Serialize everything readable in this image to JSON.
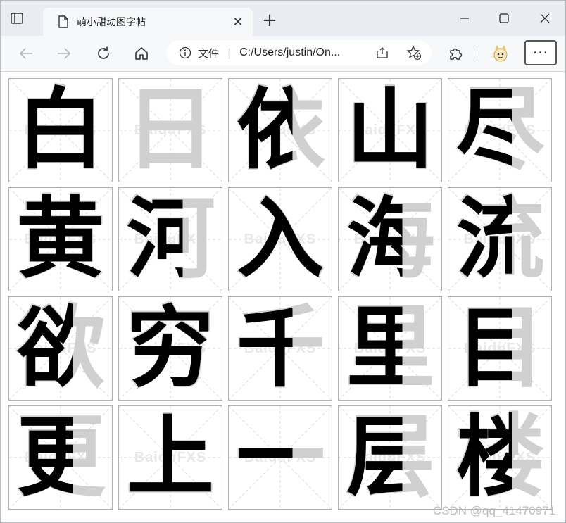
{
  "browser": {
    "tab_title": "萌小甜动图字帖",
    "address_label": "文件",
    "address_url": "C:/Users/justin/On..."
  },
  "cells": [
    {
      "char": "白",
      "state": "complete"
    },
    {
      "char": "日",
      "state": "ghost"
    },
    {
      "char": "依",
      "state": "partial"
    },
    {
      "char": "山",
      "state": "complete"
    },
    {
      "char": "尽",
      "state": "partial"
    },
    {
      "char": "黄",
      "state": "complete"
    },
    {
      "char": "河",
      "state": "partial"
    },
    {
      "char": "入",
      "state": "complete"
    },
    {
      "char": "海",
      "state": "partial"
    },
    {
      "char": "流",
      "state": "partial"
    },
    {
      "char": "欲",
      "state": "partial"
    },
    {
      "char": "穷",
      "state": "complete"
    },
    {
      "char": "千",
      "state": "partial"
    },
    {
      "char": "里",
      "state": "partial"
    },
    {
      "char": "目",
      "state": "partial"
    },
    {
      "char": "更",
      "state": "partial"
    },
    {
      "char": "上",
      "state": "complete"
    },
    {
      "char": "一",
      "state": "partial"
    },
    {
      "char": "层",
      "state": "partial"
    },
    {
      "char": "楼",
      "state": "partial"
    }
  ],
  "cell_watermark": "BaiduFXS",
  "page_watermark": "CSDN @qq_41470971",
  "colors": {
    "ink": "#000000",
    "ghost": "#d0d0d0",
    "guide": "#dadada"
  }
}
